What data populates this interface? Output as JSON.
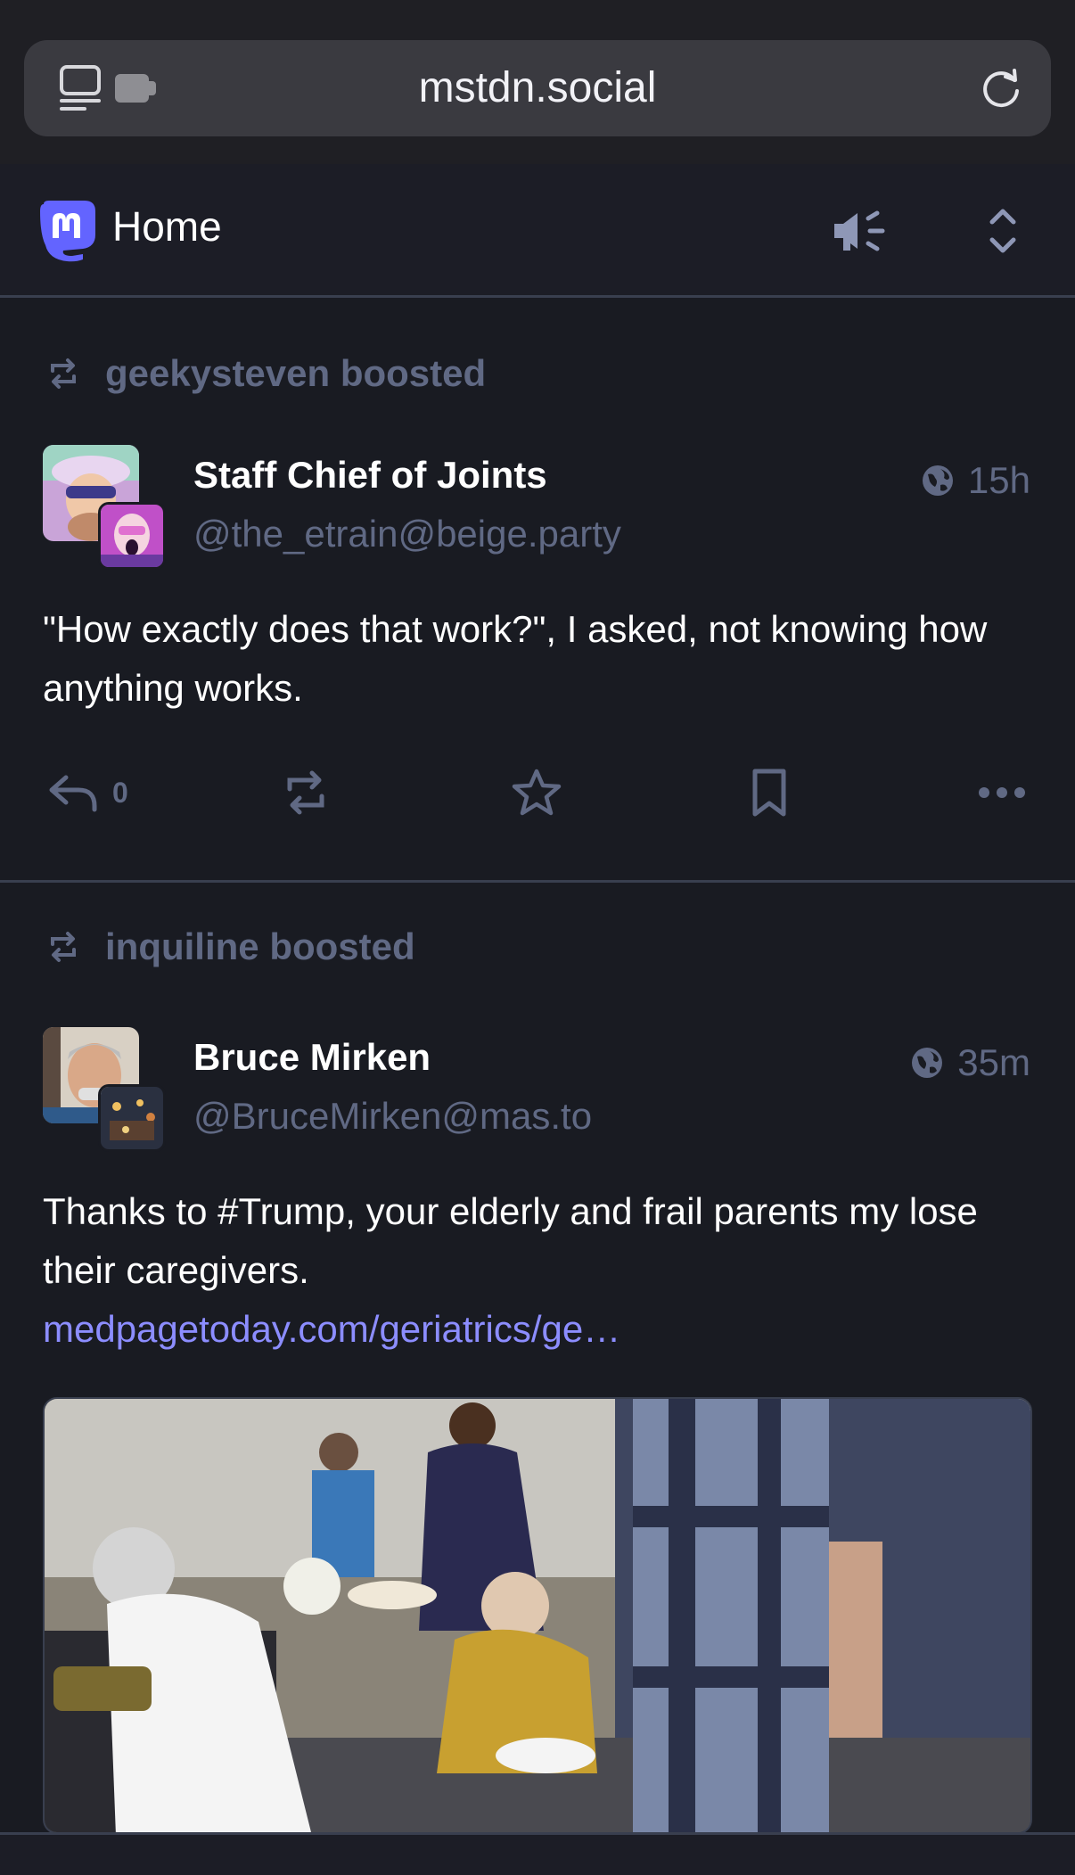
{
  "browser": {
    "url": "mstdn.social",
    "icons": [
      "reader-icon",
      "extension-icon",
      "reload-icon"
    ]
  },
  "header": {
    "title": "Home",
    "icons": [
      "mastodon-logo-icon",
      "announcements-icon",
      "expand-collapse-icon"
    ]
  },
  "posts": [
    {
      "boosted_by": "geekysteven boosted",
      "author_name": "Staff Chief of Joints",
      "author_handle": "@the_etrain@beige.party",
      "visibility_icon": "globe-icon",
      "time": "15h",
      "content": "\"How exactly does that work?\", I asked, not knowing how anything works.",
      "reply_count": "0"
    },
    {
      "boosted_by": "inquiline boosted",
      "author_name": "Bruce Mirken",
      "author_handle": "@BruceMirken@mas.to",
      "visibility_icon": "globe-icon",
      "time": "35m",
      "content_prefix": "Thanks to ",
      "hashtag": "#Trump",
      "content_suffix": ", your elderly and frail parents my lose their caregivers.",
      "link": "medpagetoday.com/geriatrics/ge…",
      "media_alt": "Elderly residents at a buffet event, one seated in a wheelchair holding a plate"
    }
  ],
  "colors": {
    "background": "#191b22",
    "muted": "#606984",
    "accent": "#8c8dff",
    "brand": "#6364ff"
  }
}
